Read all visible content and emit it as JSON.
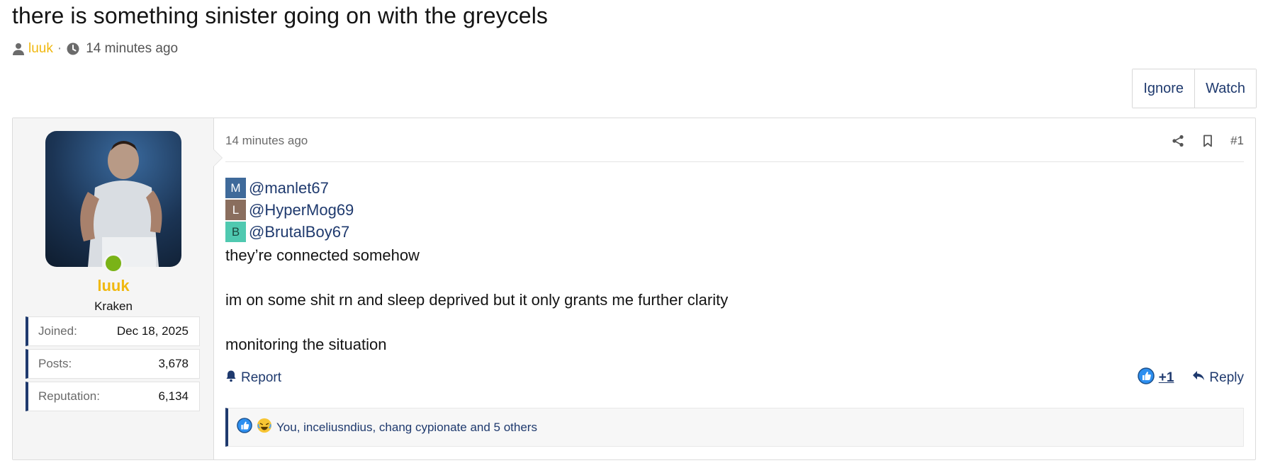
{
  "thread": {
    "title": "there is something sinister going on with the greycels",
    "author": "luuk",
    "separator": "·",
    "time": "14 minutes ago"
  },
  "actions": {
    "ignore_label": "Ignore",
    "watch_label": "Watch"
  },
  "post": {
    "user": {
      "name": "luuk",
      "title": "Kraken",
      "online": true,
      "stats": [
        {
          "label": "Joined:",
          "value": "Dec 18, 2025"
        },
        {
          "label": "Posts:",
          "value": "3,678"
        },
        {
          "label": "Reputation:",
          "value": "6,134"
        }
      ]
    },
    "time": "14 minutes ago",
    "number": "#1",
    "mentions": [
      {
        "initial": "M",
        "handle": "@manlet67",
        "color": "#3f6a9a"
      },
      {
        "initial": "L",
        "handle": "@HyperMog69",
        "color": "#8a6e5e"
      },
      {
        "initial": "B",
        "handle": "@BrutalBoy67",
        "color": "#4fc9b0"
      }
    ],
    "body": {
      "line1": "they’re connected somehow",
      "line2": "im on some shit rn and sleep deprived but it only grants me further clarity",
      "line3": "monitoring the situation"
    },
    "footer": {
      "report_label": "Report",
      "reaction_count": "+1",
      "reply_label": "Reply"
    },
    "reactions_text": "You, inceliusndius, chang cypionate and 5 others"
  },
  "colors": {
    "accent_blue": "#1f3a6e",
    "username_gold": "#f0b810",
    "online_green": "#7ab317"
  }
}
